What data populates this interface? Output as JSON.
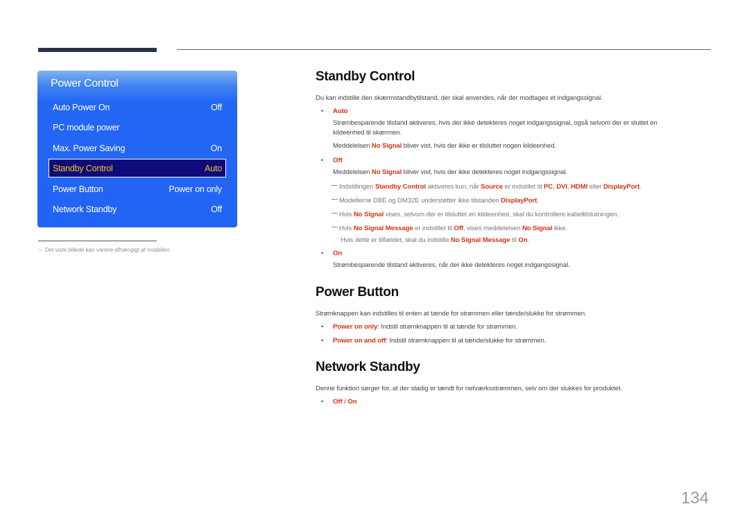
{
  "osd_menu": {
    "title": "Power Control",
    "items": [
      {
        "label": "Auto Power On",
        "value": "Off",
        "selected": false
      },
      {
        "label": "PC module power",
        "value": "",
        "selected": false
      },
      {
        "label": "Max. Power Saving",
        "value": "On",
        "selected": false
      },
      {
        "label": "Standby Control",
        "value": "Auto",
        "selected": true
      },
      {
        "label": "Power Button",
        "value": "Power on only",
        "selected": false
      },
      {
        "label": "Network Standby",
        "value": "Off",
        "selected": false
      }
    ]
  },
  "footnote": "Det viste billede kan variere afhængigt af modellen.",
  "sections": {
    "standby": {
      "title": "Standby Control",
      "intro": "Du kan indstille den skærmstandbytilstand, der skal anvendes, når der modtages et indgangssignal.",
      "auto_label": "Auto",
      "auto_desc_1": "Strømbesparende tilstand aktiveres, hvis der ikke detekteres noget indgangssignal, også selvom der er sluttet en",
      "auto_desc_2": "kildeenhed til skærmen.",
      "auto_msg_pre": "Meddelelsen ",
      "auto_msg_red": "No Signal",
      "auto_msg_post": " bliver vist, hvis der ikke er tilsluttet nogen kildeenhed.",
      "off_label": "Off",
      "off_msg_pre": "Meddelelsen ",
      "off_msg_red": "No Signal",
      "off_msg_post": " bliver vist, hvis der ikke detekteres noget indgangssignal.",
      "note1": {
        "t1": "Indstillingen ",
        "r1": "Standby Control",
        "t2": " aktiveres kun, når ",
        "r2": "Source",
        "t3": " er indstillet til ",
        "r3": "PC",
        "t4": ", ",
        "r4": "DVI",
        "t5": ", ",
        "r5": "HDMI",
        "t6": " eller ",
        "r6": "DisplayPort",
        "t7": "."
      },
      "note2": {
        "t1": "Modellerne DBE og DM32E understøtter ikke tilstanden ",
        "r1": "DisplayPort",
        "t2": "."
      },
      "note3": {
        "t1": "Hvis ",
        "r1": "No Signal",
        "t2": " vises, selvom der er tilsluttet en kildeenhed, skal du kontrollere kabeltilslutningen."
      },
      "note4": {
        "t1": "Hvis ",
        "r1": "No Signal Message",
        "t2": " er indstillet til ",
        "r2": "Off",
        "t3": ", vises meddelelsen ",
        "r3": "No Signal",
        "t4": " ikke.",
        "l2_t1": "Hvis dette er tilfældet, skal du indstille ",
        "l2_r1": "No Signal Message",
        "l2_t2": " til ",
        "l2_r2": "On",
        "l2_t3": "."
      },
      "on_label": "On",
      "on_desc": "Strømbesparende tilstand aktiveres, når der ikke detekteres noget indgangssignal."
    },
    "power_button": {
      "title": "Power Button",
      "intro": "Strømknappen kan indstilles til enten at tænde for strømmen eller tænde/slukke for strømmen.",
      "opt1_label": "Power on only",
      "opt1_desc": ": Indstil strømknappen til at tænde for strømmen.",
      "opt2_label": "Power on and off",
      "opt2_desc": ": Indstil strømknappen til at tænde/slukke for strømmen."
    },
    "network_standby": {
      "title": "Network Standby",
      "intro": "Denne funktion sørger for, at der stadig er tændt for netværksstrømmen, selv om der slukkes for produktet.",
      "opt_off": "Off",
      "opt_sep": " / ",
      "opt_on": "On"
    }
  },
  "bullet_glyph": "•",
  "page_number": "134"
}
